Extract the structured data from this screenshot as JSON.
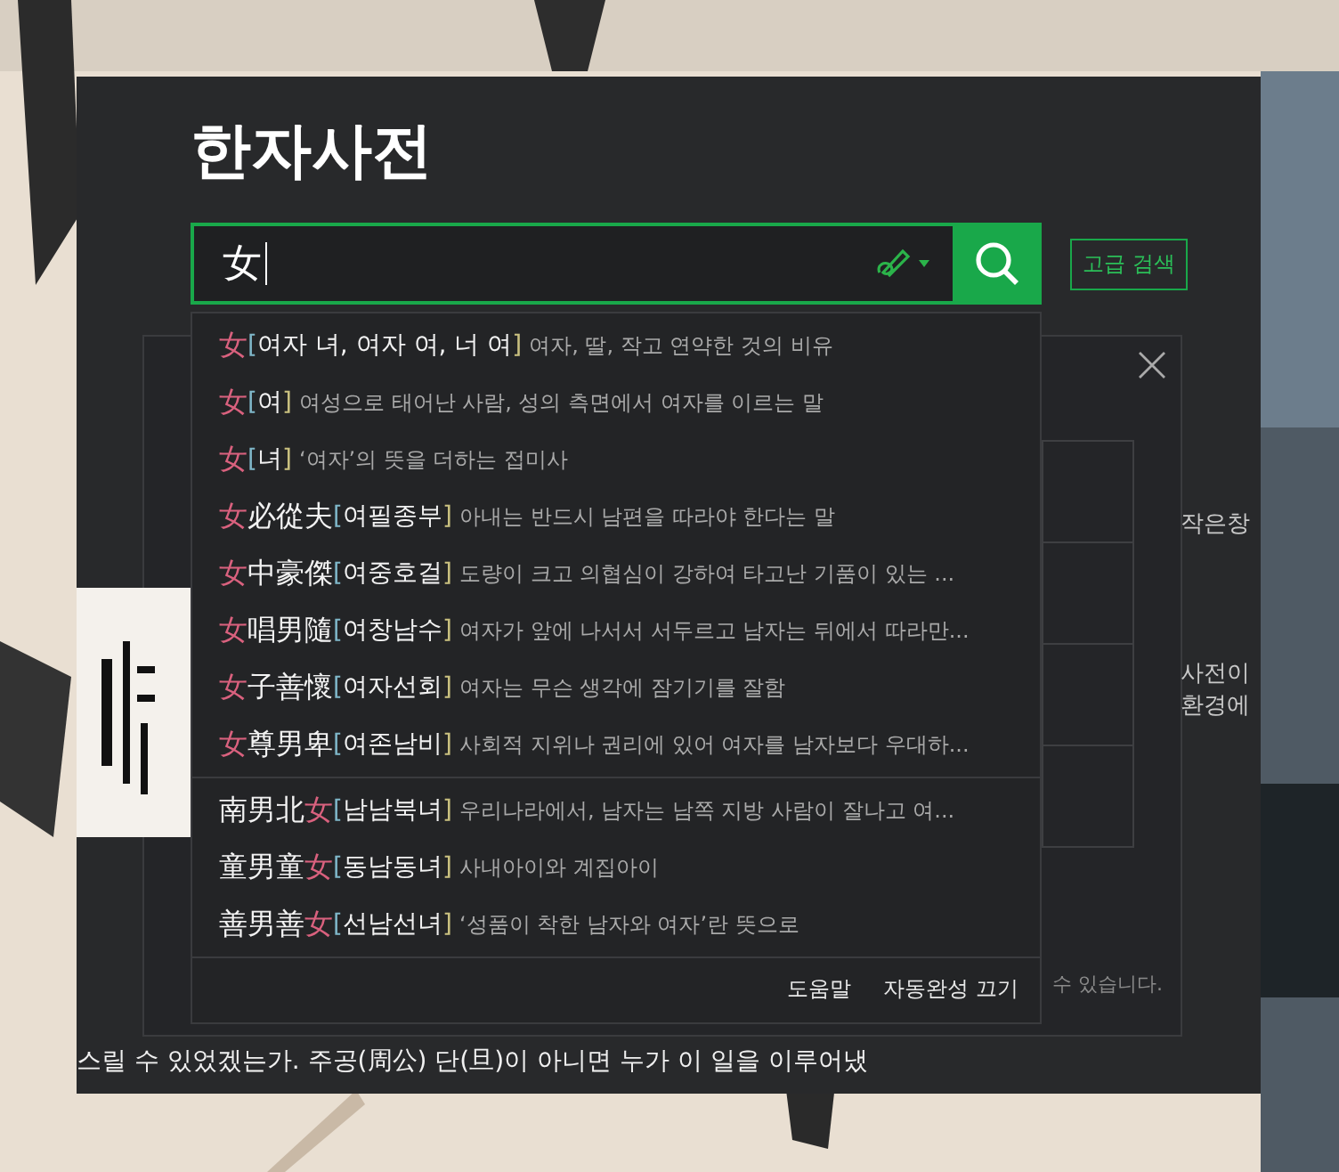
{
  "title": "한자사전",
  "search": {
    "value": "女",
    "advanced_button": "고급 검색"
  },
  "background_dialog": {
    "side_texts": [
      "작은창",
      "사전이",
      "환경에"
    ],
    "hint": "수 있습니다."
  },
  "suggestions": {
    "groups": [
      {
        "rows": [
          {
            "hanja": [
              {
                "text": "女",
                "match": true
              }
            ],
            "bracket_open": "[",
            "reading": "여자 녀, 여자 여, 너 여",
            "bracket_close": "]",
            "description": "여자, 딸, 작고 연약한 것의 비유"
          },
          {
            "hanja": [
              {
                "text": "女",
                "match": true
              }
            ],
            "bracket_open": "[",
            "reading": "여",
            "bracket_close": "]",
            "description": "여성으로 태어난 사람, 성의 측면에서 여자를 이르는 말"
          },
          {
            "hanja": [
              {
                "text": "女",
                "match": true
              }
            ],
            "bracket_open": "[",
            "reading": "녀",
            "bracket_close": "]",
            "description": "‘여자’의 뜻을 더하는 접미사"
          },
          {
            "hanja": [
              {
                "text": "女",
                "match": true
              },
              {
                "text": "必從夫",
                "match": false
              }
            ],
            "bracket_open": "[",
            "reading": "여필종부",
            "bracket_close": "]",
            "description": "아내는 반드시 남편을 따라야 한다는 말"
          },
          {
            "hanja": [
              {
                "text": "女",
                "match": true
              },
              {
                "text": "中豪傑",
                "match": false
              }
            ],
            "bracket_open": "[",
            "reading": "여중호걸",
            "bracket_close": "]",
            "description": "도량이 크고 의협심이 강하여 타고난 기품이 있는 ..."
          },
          {
            "hanja": [
              {
                "text": "女",
                "match": true
              },
              {
                "text": "唱男隨",
                "match": false
              }
            ],
            "bracket_open": "[",
            "reading": "여창남수",
            "bracket_close": "]",
            "description": "여자가 앞에 나서서 서두르고 남자는 뒤에서 따라만..."
          },
          {
            "hanja": [
              {
                "text": "女",
                "match": true
              },
              {
                "text": "子善懷",
                "match": false
              }
            ],
            "bracket_open": "[",
            "reading": "여자선회",
            "bracket_close": "]",
            "description": "여자는 무슨 생각에 잠기기를 잘함"
          },
          {
            "hanja": [
              {
                "text": "女",
                "match": true
              },
              {
                "text": "尊男卑",
                "match": false
              }
            ],
            "bracket_open": "[",
            "reading": "여존남비",
            "bracket_close": "]",
            "description": "사회적 지위나 권리에 있어 여자를 남자보다 우대하..."
          }
        ]
      },
      {
        "rows": [
          {
            "hanja": [
              {
                "text": "南男北",
                "match": false
              },
              {
                "text": "女",
                "match": true
              }
            ],
            "bracket_open": "[",
            "reading": "남남북녀",
            "bracket_close": "]",
            "description": "우리나라에서, 남자는 남쪽 지방 사람이 잘나고 여..."
          },
          {
            "hanja": [
              {
                "text": "童男童",
                "match": false
              },
              {
                "text": "女",
                "match": true
              }
            ],
            "bracket_open": "[",
            "reading": "동남동녀",
            "bracket_close": "]",
            "description": "사내아이와 계집아이"
          },
          {
            "hanja": [
              {
                "text": "善男善",
                "match": false
              },
              {
                "text": "女",
                "match": true
              }
            ],
            "bracket_open": "[",
            "reading": "선남선녀",
            "bracket_close": "]",
            "description": "‘성품이 착한 남자와 여자’란 뜻으로"
          }
        ]
      }
    ],
    "footer_links": [
      "도움말",
      "자동완성 끄기"
    ]
  },
  "body_text": "스릴 수 있었겠는가. 주공(周公) 단(旦)이 아니면 누가 이 일을 이루어냈"
}
